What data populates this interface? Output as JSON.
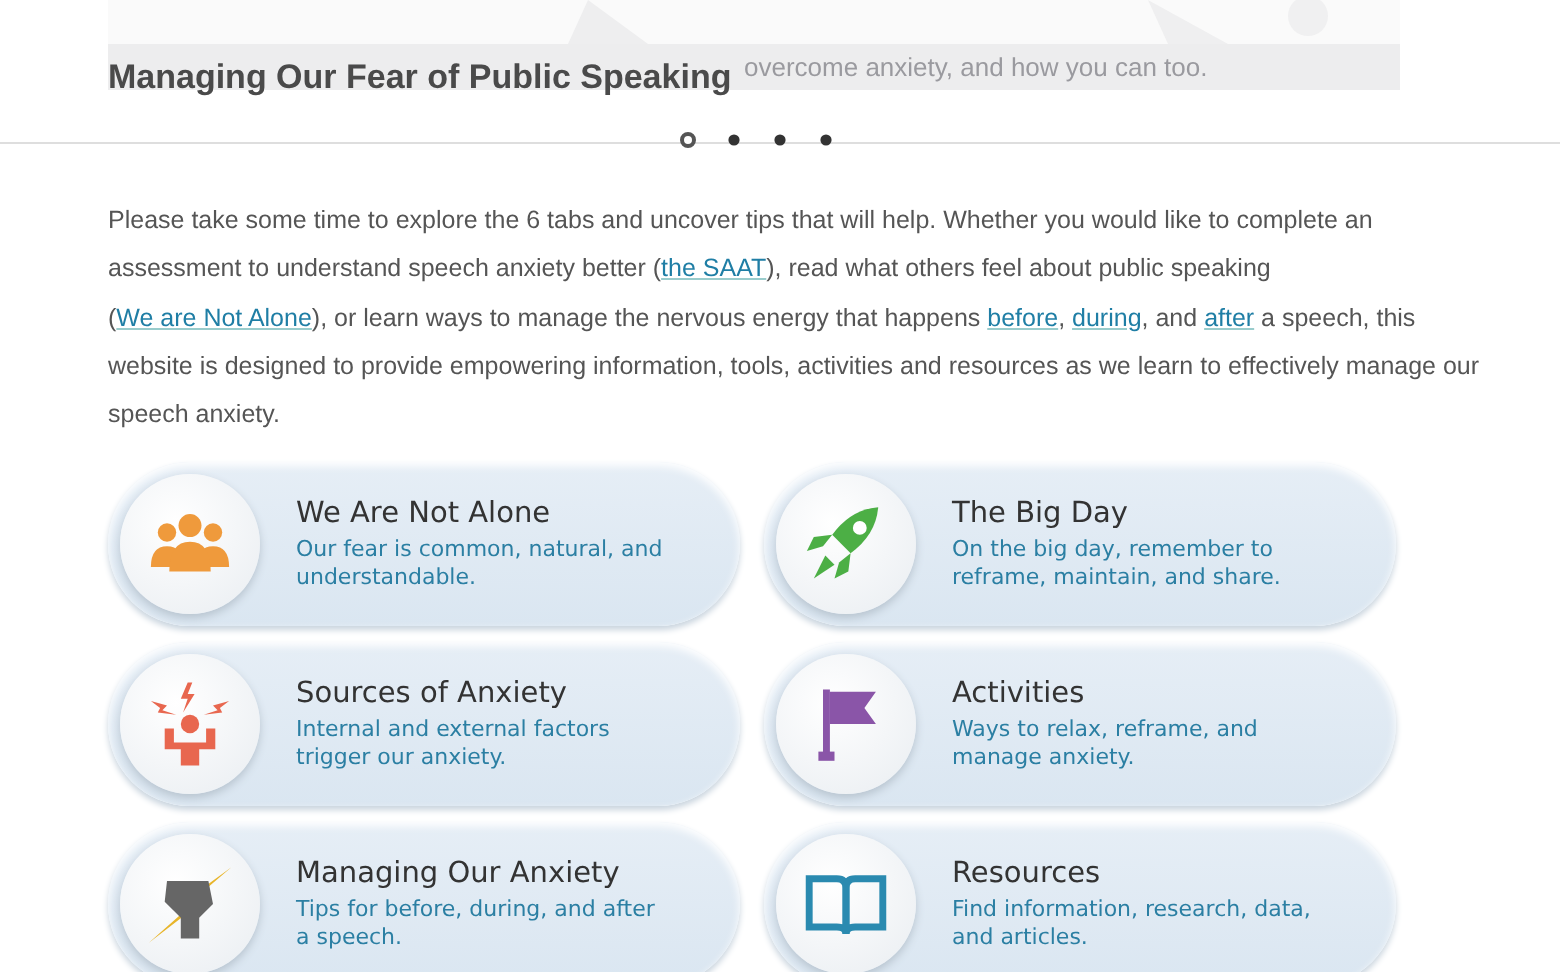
{
  "banner": {
    "caption": "overcome anxiety, and how you can too."
  },
  "title": "Managing Our Fear of Public Speaking",
  "carousel_dots": [
    {
      "selected": true
    },
    {
      "selected": false
    },
    {
      "selected": false
    },
    {
      "selected": false
    }
  ],
  "intro": [
    {
      "text": "Please take some time to explore the 6 tabs and uncover tips that will help. Whether you would like to complete an assessment to understand speech anxiety better (",
      "kind": "text"
    },
    {
      "text": "the SAAT",
      "kind": "link"
    },
    {
      "text": "), read what others feel about public speaking (",
      "kind": "text"
    },
    {
      "text": "We are Not Alone",
      "kind": "link"
    },
    {
      "text": "), or learn ways to manage the nervous energy that happens ",
      "kind": "text"
    },
    {
      "text": "before",
      "kind": "link"
    },
    {
      "text": ", ",
      "kind": "text"
    },
    {
      "text": "during",
      "kind": "link"
    },
    {
      "text": ", and ",
      "kind": "text"
    },
    {
      "text": "after",
      "kind": "link"
    },
    {
      "text": " a speech, this website is designed to provide empowering information, tools, activities and resources as we learn to effectively manage our speech anxiety.",
      "kind": "text"
    }
  ],
  "cards": [
    {
      "kind": "people",
      "title": "We Are Not Alone",
      "description": "Our fear is common, natural, and understandable."
    },
    {
      "kind": "rocket",
      "title": "The Big Day",
      "description": "On the big day, remember to reframe, maintain, and share."
    },
    {
      "kind": "alarm",
      "title": "Sources of Anxiety",
      "description": "Internal and external factors trigger our anxiety."
    },
    {
      "kind": "flag",
      "title": "Activities",
      "description": "Ways to relax, reframe, and manage anxiety."
    },
    {
      "kind": "fist",
      "title": "Managing Our Anxiety",
      "description": "Tips for before, during, and after a speech."
    },
    {
      "kind": "book",
      "title": "Resources",
      "description": "Find information, research, data, and articles."
    }
  ]
}
